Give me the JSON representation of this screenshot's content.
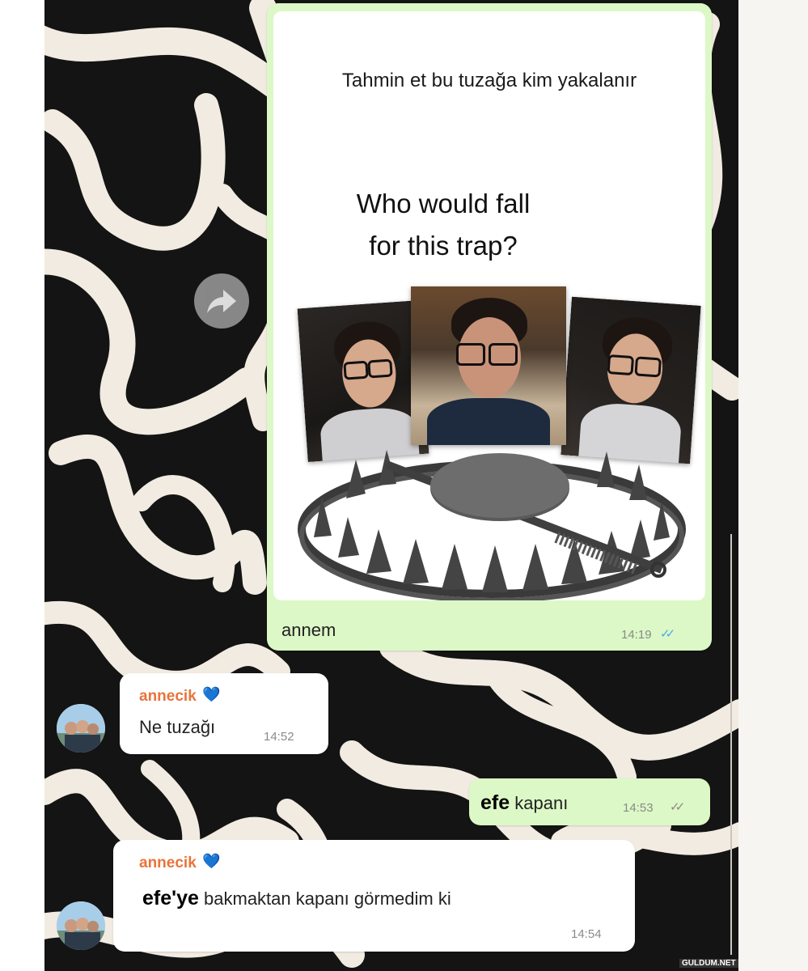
{
  "post": {
    "headline_tr": "Tahmin et bu tuzağa kim yakalanır",
    "headline_en_line1": "Who would fall",
    "headline_en_line2": "for this trap?",
    "caption": "annem",
    "time": "14:19",
    "status": "read"
  },
  "messages": [
    {
      "direction": "incoming",
      "sender": "annecik",
      "sender_emoji": "💙",
      "text": "Ne tuzağı",
      "time": "14:52"
    },
    {
      "direction": "outgoing",
      "text_bold": "efe",
      "text": "kapanı",
      "time": "14:53",
      "status": "sent"
    },
    {
      "direction": "incoming",
      "sender": "annecik",
      "sender_emoji": "💙",
      "text_bold": "efe'ye",
      "text": "bakmaktan kapanı görmedim ki",
      "time": "14:54"
    }
  ],
  "watermark": "GULDUM.NET",
  "colors": {
    "outgoing_bubble": "#dcf8c6",
    "incoming_bubble": "#ffffff",
    "sender_name": "#e8743b",
    "read_ticks": "#4fa9e8",
    "heart": "#62b6ee",
    "wallpaper_dark": "#141414",
    "wallpaper_light": "#f1ebe1"
  },
  "icons": [
    "forward-icon",
    "double-check-icon",
    "heart-emoji"
  ]
}
